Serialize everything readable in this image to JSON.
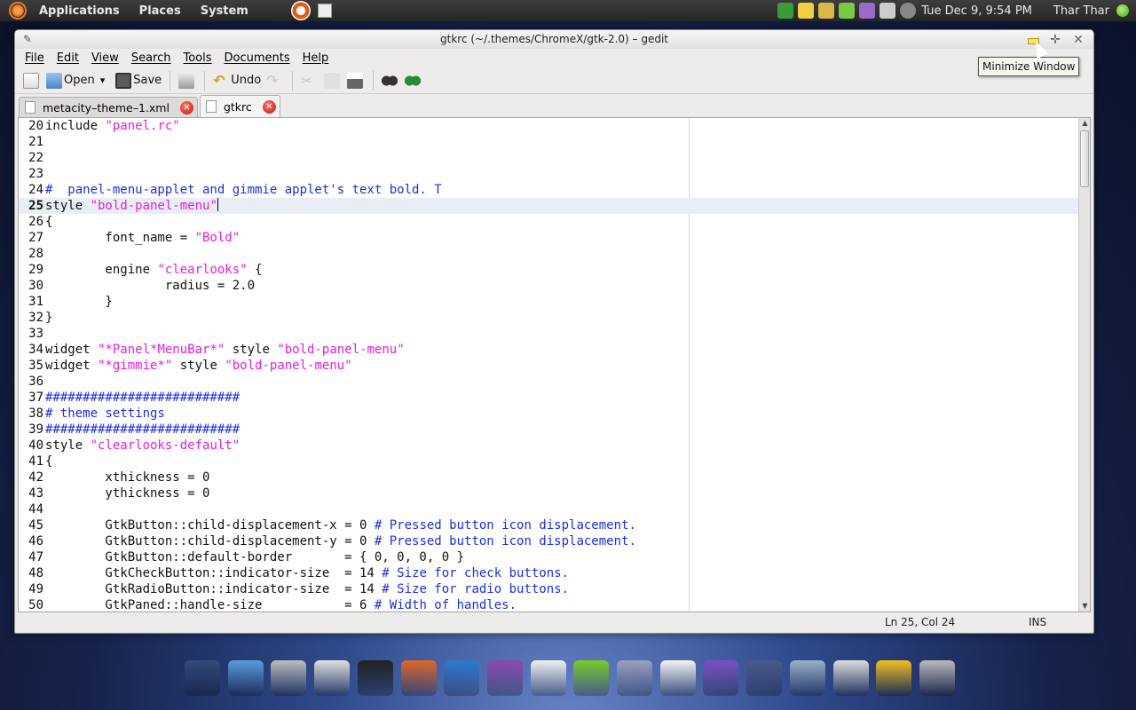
{
  "top_panel": {
    "menus": [
      "Applications",
      "Places",
      "System"
    ],
    "clock": "Tue Dec  9,  9:54 PM",
    "user": "Thar Thar"
  },
  "window": {
    "title": "gtkrc (~/.themes/ChromeX/gtk-2.0) – gedit",
    "menu": [
      "File",
      "Edit",
      "View",
      "Search",
      "Tools",
      "Documents",
      "Help"
    ],
    "toolbar": {
      "open_label": "Open",
      "save_label": "Save",
      "undo_label": "Undo"
    },
    "tabs": [
      {
        "label": "metacity–theme–1.xml",
        "active": false
      },
      {
        "label": "gtkrc",
        "active": true
      }
    ],
    "editor": {
      "current_line": 25,
      "lines": [
        {
          "n": "20",
          "parts": [
            [
              "txt",
              "include "
            ],
            [
              "str",
              "\"panel.rc\""
            ]
          ]
        },
        {
          "n": "21",
          "parts": []
        },
        {
          "n": "22",
          "parts": []
        },
        {
          "n": "23",
          "parts": []
        },
        {
          "n": "24",
          "parts": [
            [
              "cmt",
              "#  panel-menu-applet and gimmie applet's text bold. T"
            ]
          ]
        },
        {
          "n": "25",
          "parts": [
            [
              "txt",
              "style "
            ],
            [
              "str",
              "\"bold-panel-menu\""
            ]
          ]
        },
        {
          "n": "26",
          "parts": [
            [
              "txt",
              "{"
            ]
          ]
        },
        {
          "n": "27",
          "parts": [
            [
              "txt",
              "        font_name = "
            ],
            [
              "str",
              "\"Bold\""
            ]
          ]
        },
        {
          "n": "28",
          "parts": []
        },
        {
          "n": "29",
          "parts": [
            [
              "txt",
              "        engine "
            ],
            [
              "str",
              "\"clearlooks\""
            ],
            [
              "txt",
              " {"
            ]
          ]
        },
        {
          "n": "30",
          "parts": [
            [
              "txt",
              "                radius = 2.0"
            ]
          ]
        },
        {
          "n": "31",
          "parts": [
            [
              "txt",
              "        }"
            ]
          ]
        },
        {
          "n": "32",
          "parts": [
            [
              "txt",
              "}"
            ]
          ]
        },
        {
          "n": "33",
          "parts": []
        },
        {
          "n": "34",
          "parts": [
            [
              "txt",
              "widget "
            ],
            [
              "str",
              "\"*Panel*MenuBar*\""
            ],
            [
              "txt",
              " style "
            ],
            [
              "str",
              "\"bold-panel-menu\""
            ]
          ]
        },
        {
          "n": "35",
          "parts": [
            [
              "txt",
              "widget "
            ],
            [
              "str",
              "\"*gimmie*\""
            ],
            [
              "txt",
              " style "
            ],
            [
              "str",
              "\"bold-panel-menu\""
            ]
          ]
        },
        {
          "n": "36",
          "parts": []
        },
        {
          "n": "37",
          "parts": [
            [
              "cmt",
              "##########################"
            ]
          ]
        },
        {
          "n": "38",
          "parts": [
            [
              "cmt",
              "# theme settings"
            ]
          ]
        },
        {
          "n": "39",
          "parts": [
            [
              "cmt",
              "##########################"
            ]
          ]
        },
        {
          "n": "40",
          "parts": [
            [
              "txt",
              "style "
            ],
            [
              "str",
              "\"clearlooks-default\""
            ]
          ]
        },
        {
          "n": "41",
          "parts": [
            [
              "txt",
              "{"
            ]
          ]
        },
        {
          "n": "42",
          "parts": [
            [
              "txt",
              "        xthickness = 0"
            ]
          ]
        },
        {
          "n": "43",
          "parts": [
            [
              "txt",
              "        ythickness = 0"
            ]
          ]
        },
        {
          "n": "44",
          "parts": []
        },
        {
          "n": "45",
          "parts": [
            [
              "txt",
              "        GtkButton::child-displacement-x = 0 "
            ],
            [
              "cmt",
              "# Pressed button icon displacement."
            ]
          ]
        },
        {
          "n": "46",
          "parts": [
            [
              "txt",
              "        GtkButton::child-displacement-y = 0 "
            ],
            [
              "cmt",
              "# Pressed button icon displacement."
            ]
          ]
        },
        {
          "n": "47",
          "parts": [
            [
              "txt",
              "        GtkButton::default-border       = { 0, 0, 0, 0 }"
            ]
          ]
        },
        {
          "n": "48",
          "parts": [
            [
              "txt",
              "        GtkCheckButton::indicator-size  = 14 "
            ],
            [
              "cmt",
              "# Size for check buttons."
            ]
          ]
        },
        {
          "n": "49",
          "parts": [
            [
              "txt",
              "        GtkRadioButton::indicator-size  = 14 "
            ],
            [
              "cmt",
              "# Size for radio buttons."
            ]
          ]
        },
        {
          "n": "50",
          "parts": [
            [
              "txt",
              "        GtkPaned::handle-size           = 6 "
            ],
            [
              "cmt",
              "# Width of handles."
            ]
          ]
        }
      ]
    },
    "status": {
      "position": "Ln 25, Col 24",
      "mode": "INS"
    }
  },
  "tooltip": "Minimize Window",
  "colors": {
    "string": "#e51ee0",
    "comment": "#1c2fe0",
    "current_line": "#e8edf6"
  },
  "dock_icons": [
    "desktop-icon",
    "folder-icon",
    "drive-icon",
    "usb-drive-icon",
    "terminal-icon",
    "firefox-icon",
    "thunderbird-icon",
    "pidgin-icon",
    "text-editor-icon",
    "media-player-icon",
    "compass-icon",
    "document-icon",
    "globe-icon",
    "save-icon",
    "file-cabinet-icon",
    "window-icon",
    "notes-icon",
    "trash-icon"
  ]
}
